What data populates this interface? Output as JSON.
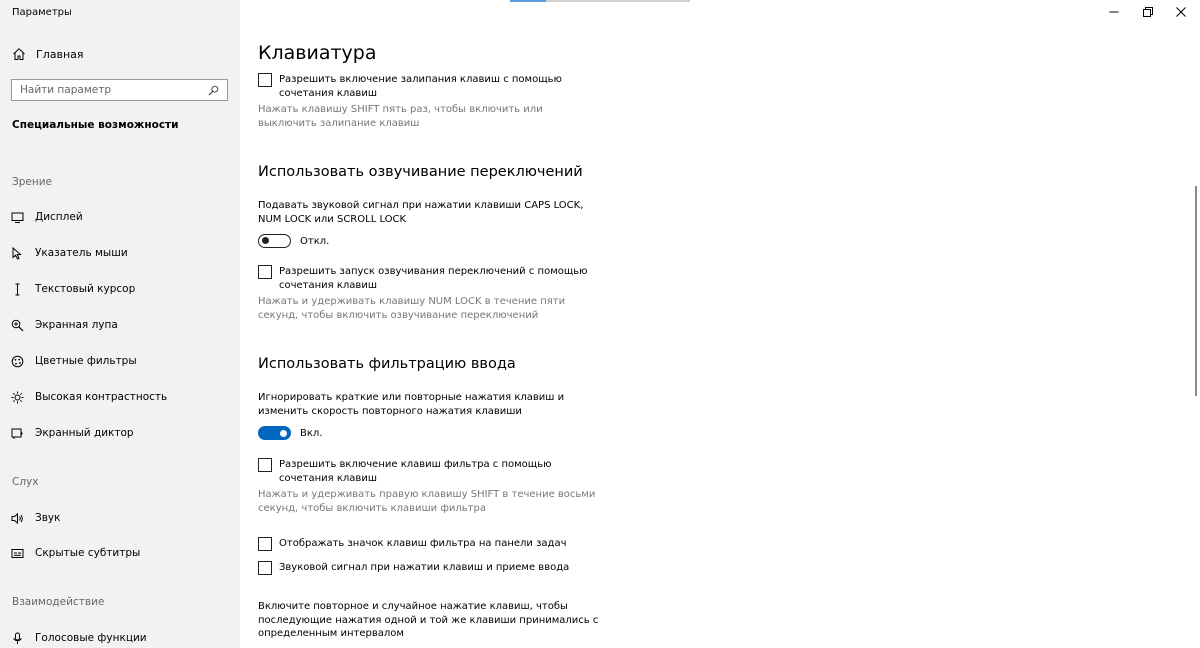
{
  "window": {
    "title": "Параметры",
    "minimize_icon": "minimize-icon",
    "restore_icon": "restore-icon",
    "close_icon": "close-icon"
  },
  "sidebar": {
    "home": {
      "label": "Главная",
      "icon": "home-icon"
    },
    "search": {
      "placeholder": "Найти параметр",
      "value": "",
      "icon": "search-icon"
    },
    "current_section": "Специальные возможности",
    "groups": [
      {
        "label": "Зрение",
        "items": [
          {
            "label": "Дисплей",
            "icon": "monitor-icon"
          },
          {
            "label": "Указатель мыши",
            "icon": "mouse-pointer-icon"
          },
          {
            "label": "Текстовый курсор",
            "icon": "text-cursor-icon"
          },
          {
            "label": "Экранная лупа",
            "icon": "magnifier-icon"
          },
          {
            "label": "Цветные фильтры",
            "icon": "color-filter-icon"
          },
          {
            "label": "Высокая контрастность",
            "icon": "contrast-icon"
          },
          {
            "label": "Экранный диктор",
            "icon": "narrator-icon"
          }
        ]
      },
      {
        "label": "Слух",
        "items": [
          {
            "label": "Звук",
            "icon": "speaker-icon"
          },
          {
            "label": "Скрытые субтитры",
            "icon": "captions-icon"
          }
        ]
      },
      {
        "label": "Взаимодействие",
        "items": [
          {
            "label": "Голосовые функции",
            "icon": "microphone-icon"
          }
        ]
      }
    ]
  },
  "main": {
    "title": "Клавиатура",
    "sticky": {
      "checkbox_label": "Разрешить включение залипания клавиш с помощью сочетания клавиш",
      "checked": false,
      "hint": "Нажать клавишу SHIFT пять раз, чтобы включить или выключить залипание клавиш"
    },
    "toggle_keys": {
      "heading": "Использовать озвучивание переключений",
      "description": "Подавать звуковой сигнал при нажатии клавиши CAPS LOCK, NUM LOCK или SCROLL LOCK",
      "toggle_state": "Откл.",
      "toggle_on": false,
      "checkbox_label": "Разрешить запуск озвучивания переключений с помощью сочетания клавиш",
      "checked": false,
      "hint": "Нажать и удерживать клавишу NUM LOCK в течение пяти секунд, чтобы включить озвучивание переключений"
    },
    "filter_keys": {
      "heading": "Использовать фильтрацию ввода",
      "description": "Игнорировать краткие или повторные нажатия клавиш и изменить скорость повторного нажатия клавиши",
      "toggle_state": "Вкл.",
      "toggle_on": true,
      "checkbox_label": "Разрешить включение клавиш фильтра с помощью сочетания клавиш",
      "checked": false,
      "hint": "Нажать и удерживать правую клавишу SHIFT в течение восьми секунд, чтобы включить клавиши фильтра",
      "taskbar_icon_label": "Отображать значок клавиш фильтра на панели задач",
      "taskbar_icon_checked": false,
      "beep_label": "Звуковой сигнал при нажатии клавиш и приеме ввода",
      "beep_checked": false,
      "repeat_description": "Включите повторное и случайное нажатие клавиш, чтобы последующие нажатия одной и той же клавиши принимались с определенным интервалом"
    }
  }
}
